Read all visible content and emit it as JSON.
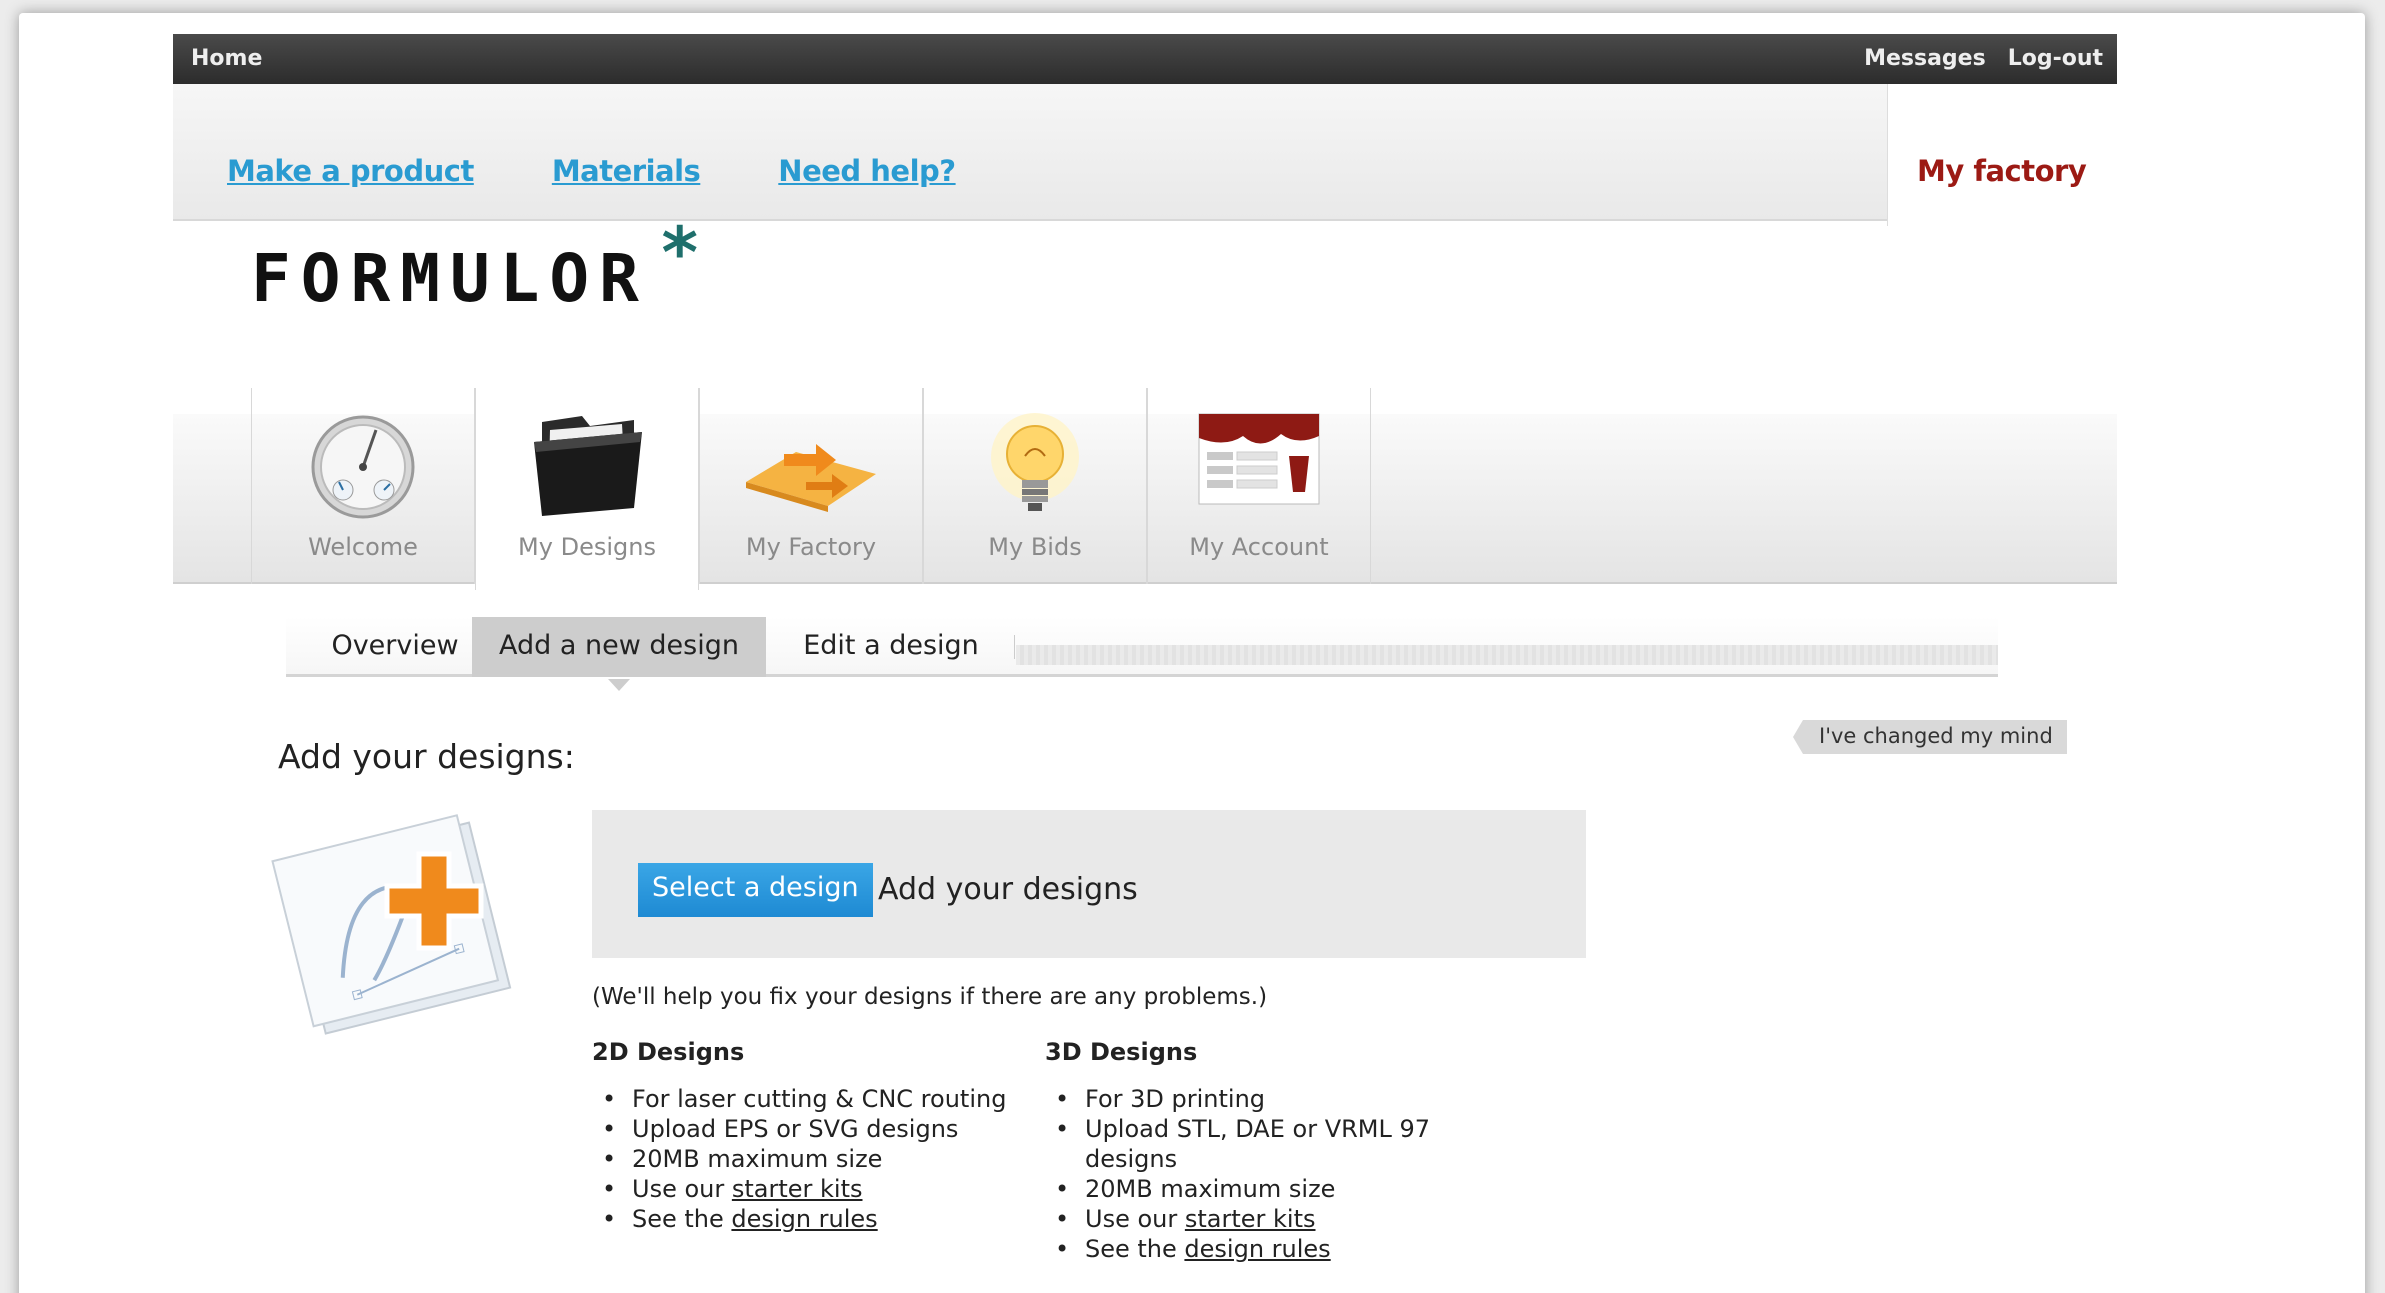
{
  "topbar": {
    "home": "Home",
    "messages": "Messages",
    "logout": "Log-out"
  },
  "nav": {
    "make": "Make a product",
    "materials": "Materials",
    "help": "Need help?",
    "myfactory": "My factory"
  },
  "logo": {
    "text": "FORMULOR",
    "star": "*"
  },
  "icon_tabs": [
    {
      "label": "Welcome",
      "icon": "gauge-icon"
    },
    {
      "label": "My Designs",
      "icon": "folder-icon"
    },
    {
      "label": "My Factory",
      "icon": "factory-arrow-icon"
    },
    {
      "label": "My Bids",
      "icon": "lightbulb-icon"
    },
    {
      "label": "My Account",
      "icon": "account-form-icon"
    }
  ],
  "sub_tabs": {
    "overview": "Overview",
    "add": "Add a new design",
    "edit": "Edit a design"
  },
  "changed_mind": "I've changed my mind",
  "heading": "Add your designs:",
  "upload": {
    "button": "Select a design",
    "text": "Add your designs"
  },
  "help_text": "(We'll help you fix your designs if there are any problems.)",
  "columns": {
    "two_d": {
      "title": "2D Designs",
      "i1": "For laser cutting & CNC routing",
      "i2": "Upload EPS or SVG designs",
      "i3": "20MB maximum size",
      "i4_pre": "Use our ",
      "i4_link": "starter kits",
      "i5_pre": "See the ",
      "i5_link": "design rules"
    },
    "three_d": {
      "title": "3D Designs",
      "i1": "For 3D printing",
      "i2": "Upload STL, DAE or VRML 97 designs",
      "i3": "20MB maximum size",
      "i4_pre": "Use our ",
      "i4_link": "starter kits",
      "i5_pre": "See the ",
      "i5_link": "design rules"
    }
  },
  "colors": {
    "link": "#2a9bd1",
    "brand_red": "#9c1a14",
    "button": "#1e8ad3",
    "accent_teal": "#1f6f6c",
    "plus_orange": "#f08a1c"
  }
}
